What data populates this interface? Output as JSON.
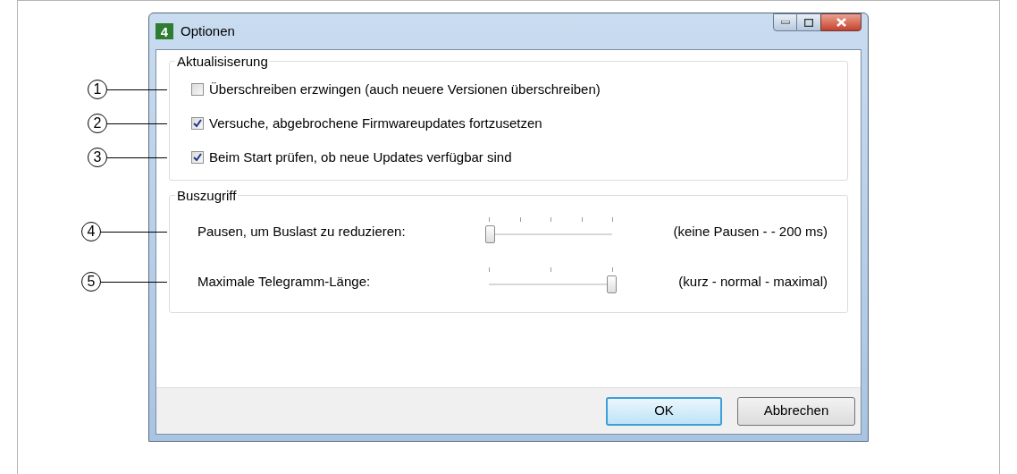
{
  "window": {
    "title": "Optionen",
    "icon_text": "4"
  },
  "groups": [
    {
      "title": "Aktualisiserung",
      "rows": [
        {
          "kind": "checkbox",
          "callout": "1",
          "label": "Überschreiben erzwingen (auch neuere Versionen überschreiben)",
          "checked": false
        },
        {
          "kind": "checkbox",
          "callout": "2",
          "label": "Versuche, abgebrochene Firmwareupdates fortzusetzen",
          "checked": true
        },
        {
          "kind": "checkbox",
          "callout": "3",
          "label": "Beim Start prüfen, ob neue Updates verfügbar sind",
          "checked": true
        }
      ]
    },
    {
      "title": "Buszugriff",
      "rows": [
        {
          "kind": "slider",
          "callout": "4",
          "label": "Pausen, um Buslast zu reduzieren:",
          "level": 0,
          "range": "(keine Pausen - - 200 ms)"
        },
        {
          "kind": "slider",
          "callout": "5",
          "label": "Maximale Telegramm-Länge:",
          "level": 1,
          "range": "(kurz - normal - maximal)"
        }
      ]
    }
  ],
  "buttons": [
    {
      "label": "OK",
      "default": true
    },
    {
      "label": "Abbrechen",
      "default": false
    }
  ]
}
